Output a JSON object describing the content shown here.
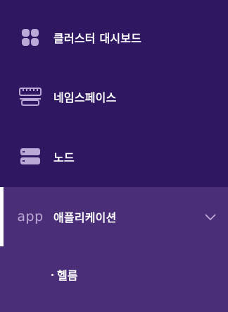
{
  "sidebar": {
    "items": [
      {
        "label": "클러스터 대시보드",
        "icon": "grid-icon"
      },
      {
        "label": "네임스페이스",
        "icon": "server-rack-icon"
      },
      {
        "label": "노드",
        "icon": "node-server-icon"
      },
      {
        "label": "애플리케이션",
        "icon": "app-text-icon",
        "icon_text": "app",
        "expanded": true,
        "active": true,
        "children": [
          {
            "label": "헬름"
          }
        ]
      }
    ]
  },
  "colors": {
    "background": "#2f1762",
    "active_background": "#4a2f78",
    "icon": "#b9a9d6",
    "text": "#ffffff"
  }
}
